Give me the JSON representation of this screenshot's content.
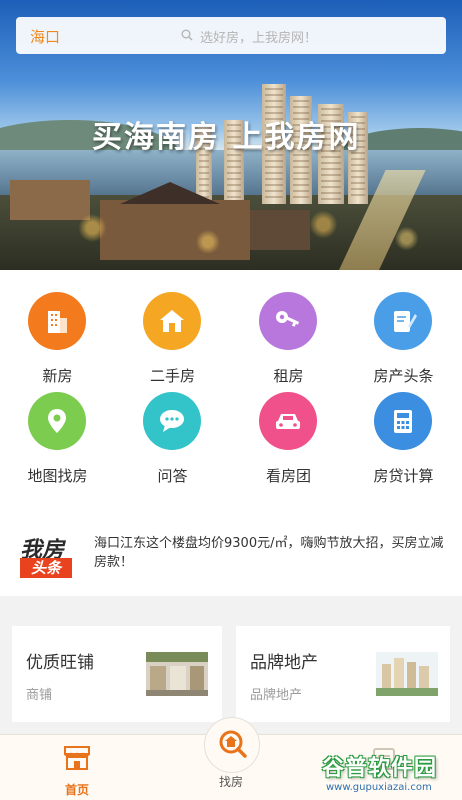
{
  "header": {
    "city": "海口",
    "search_placeholder": "选好房，上我房网！"
  },
  "banner": {
    "slogan": "买海南房  上我房网"
  },
  "categories": [
    {
      "label": "新房",
      "icon": "building-icon",
      "color": "#f37b1d"
    },
    {
      "label": "二手房",
      "icon": "house-icon",
      "color": "#f5a623"
    },
    {
      "label": "租房",
      "icon": "key-icon",
      "color": "#b877dd"
    },
    {
      "label": "房产头条",
      "icon": "edit-note-icon",
      "color": "#4a9ee8"
    },
    {
      "label": "地图找房",
      "icon": "map-pin-icon",
      "color": "#7ccc4f"
    },
    {
      "label": "问答",
      "icon": "chat-icon",
      "color": "#33c4c9"
    },
    {
      "label": "看房团",
      "icon": "car-icon",
      "color": "#f0518a"
    },
    {
      "label": "房贷计算",
      "icon": "calculator-icon",
      "color": "#3b8ee0"
    }
  ],
  "news": {
    "logo_top": "我房",
    "logo_bottom": "头条",
    "headline": "海口江东这个楼盘均价9300元/㎡，嗨购节放大招，买房立减房款！"
  },
  "cards": [
    {
      "title": "优质旺铺",
      "subtitle": "商铺"
    },
    {
      "title": "品牌地产",
      "subtitle": "品牌地产"
    }
  ],
  "bottom_nav": {
    "home": "首页",
    "find": "找房"
  },
  "watermark": {
    "main": "谷普软件园",
    "url": "www.gupuxiazai.com"
  },
  "colors": {
    "accent": "#f08a1c",
    "nav_active": "#e8731a"
  }
}
